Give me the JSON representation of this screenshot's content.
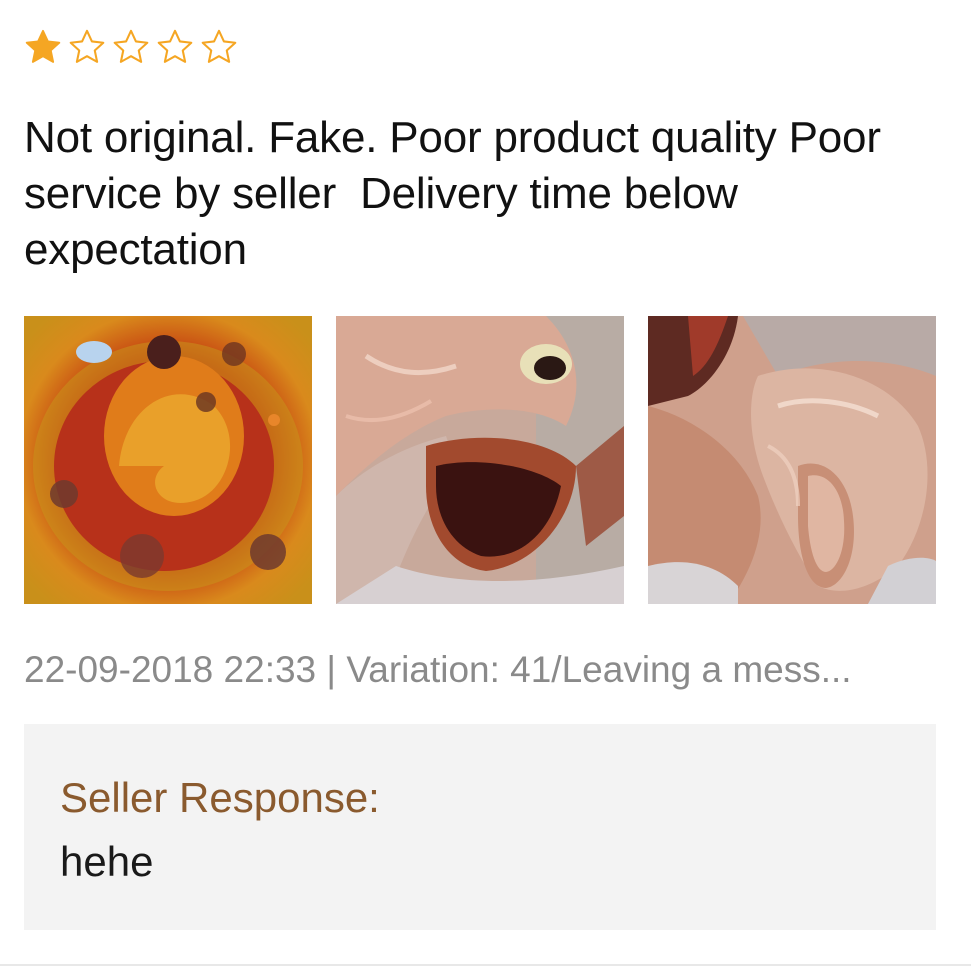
{
  "review": {
    "rating": 1,
    "rating_max": 5,
    "star_color": "#f5a623",
    "text": "Not original. Fake. Poor product quality Poor service by seller  Delivery time below expectation",
    "photos": [
      {
        "icon": "photo-thumbnail-1"
      },
      {
        "icon": "photo-thumbnail-2"
      },
      {
        "icon": "photo-thumbnail-3"
      }
    ],
    "date": "22-09-2018 22:33",
    "separator": " | ",
    "variation": "Variation: 41/Leaving a mess..."
  },
  "seller": {
    "label": "Seller Response:",
    "reply": "hehe",
    "label_color": "#8a5a2e",
    "box_color": "#f3f3f3"
  }
}
